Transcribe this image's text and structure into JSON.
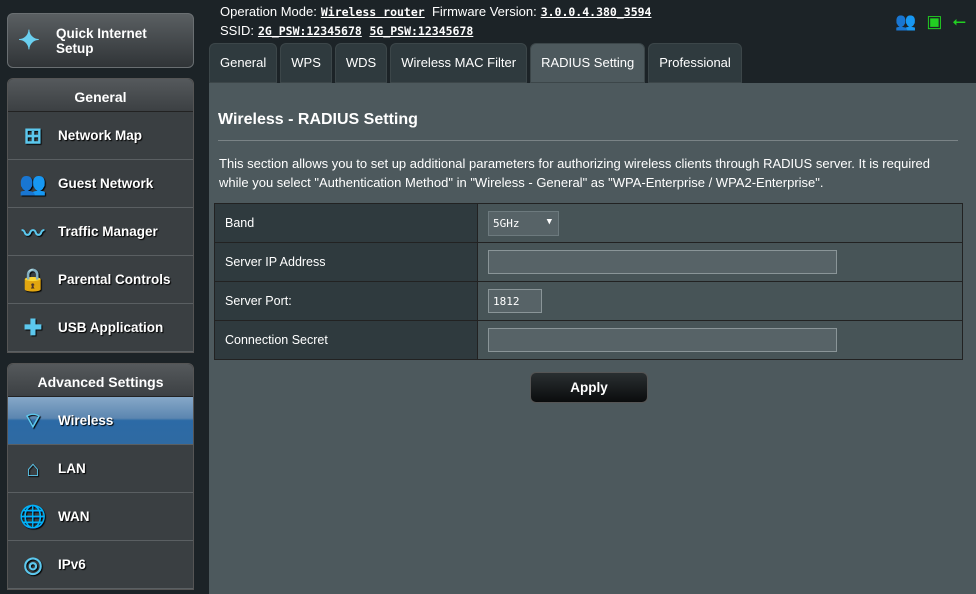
{
  "sidebar": {
    "quick_setup": "Quick Internet Setup",
    "general": {
      "title": "General",
      "items": [
        {
          "label": "Network Map",
          "icon": "network-map-icon"
        },
        {
          "label": "Guest Network",
          "icon": "guest-network-icon"
        },
        {
          "label": "Traffic Manager",
          "icon": "traffic-manager-icon"
        },
        {
          "label": "Parental Controls",
          "icon": "lock-icon"
        },
        {
          "label": "USB Application",
          "icon": "puzzle-icon"
        }
      ]
    },
    "advanced": {
      "title": "Advanced Settings",
      "items": [
        {
          "label": "Wireless",
          "icon": "wifi-icon",
          "active": true
        },
        {
          "label": "LAN",
          "icon": "home-icon"
        },
        {
          "label": "WAN",
          "icon": "globe-icon"
        },
        {
          "label": "IPv6",
          "icon": "ipv6-icon"
        }
      ]
    }
  },
  "header": {
    "op_mode_label": "Operation Mode:",
    "op_mode": "Wireless router",
    "fw_label": "Firmware Version:",
    "fw": "3.0.0.4.380_3594",
    "ssid_label": "SSID:",
    "ssid_2g": "2G_PSW:12345678",
    "ssid_5g": "5G_PSW:12345678"
  },
  "tabs": [
    "General",
    "WPS",
    "WDS",
    "Wireless MAC Filter",
    "RADIUS Setting",
    "Professional"
  ],
  "main": {
    "title": "Wireless - RADIUS Setting",
    "description": "This section allows you to set up additional parameters for authorizing wireless clients through RADIUS server. It is required while you select \"Authentication Method\" in \"Wireless - General\" as \"WPA-Enterprise / WPA2-Enterprise\".",
    "fields": {
      "band_label": "Band",
      "band_value": "5GHz",
      "ip_label": "Server IP Address",
      "ip_value": "",
      "port_label": "Server Port:",
      "port_value": "1812",
      "secret_label": "Connection Secret",
      "secret_value": ""
    },
    "apply": "Apply"
  },
  "colors": {
    "status_ok": "#22d022",
    "user_icon": "#777777",
    "active_item": "#2f6aa2"
  }
}
